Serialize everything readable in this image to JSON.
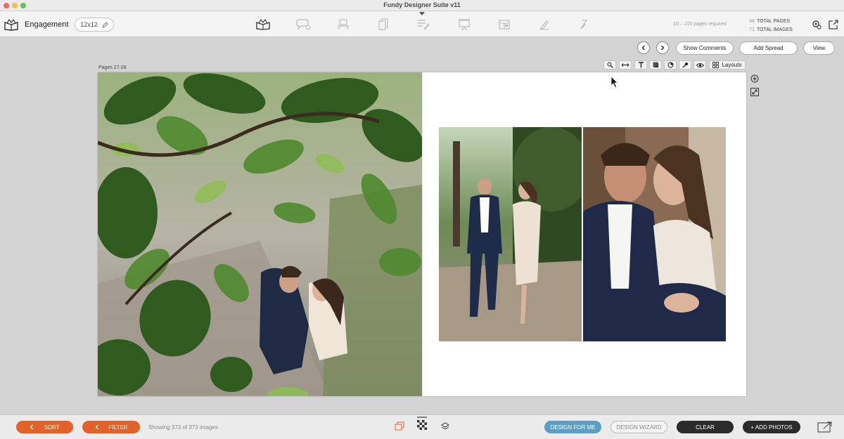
{
  "window": {
    "title": "Fundy Designer Suite v11"
  },
  "toolbar": {
    "album_name": "Engagement",
    "album_size": "12x12",
    "nav_icons": [
      "album-design-icon",
      "proofing-icon",
      "wall-art-icon",
      "cards-icon",
      "blog-collage-icon",
      "slideshow-icon",
      "layout-icon",
      "retouch-icon",
      "sales-icon"
    ],
    "pages_required": "10 – 100 pages required",
    "total_pages_count": "48",
    "total_pages_label": "TOTAL PAGES",
    "total_images_count": "71",
    "total_images_label": "TOTAL IMAGES"
  },
  "actions": {
    "show_comments": "Show Comments",
    "add_spread": "Add Spread",
    "view": "View"
  },
  "spread": {
    "pages_label": "Pages 27-28",
    "layouts_label": "Layouts"
  },
  "bottom": {
    "sort_label": "SORT",
    "filter_label": "FILTER",
    "showing_text": "Showing 373 of 373 images",
    "design_for_me": "DESIGN FOR ME",
    "design_wizard": "DESIGN WIZARD",
    "clear": "CLEAR",
    "add_photos": "+ ADD PHOTOS"
  },
  "colors": {
    "orange": "#e2622a",
    "blue": "#5d9fc4",
    "dark": "#2b2b2b"
  }
}
